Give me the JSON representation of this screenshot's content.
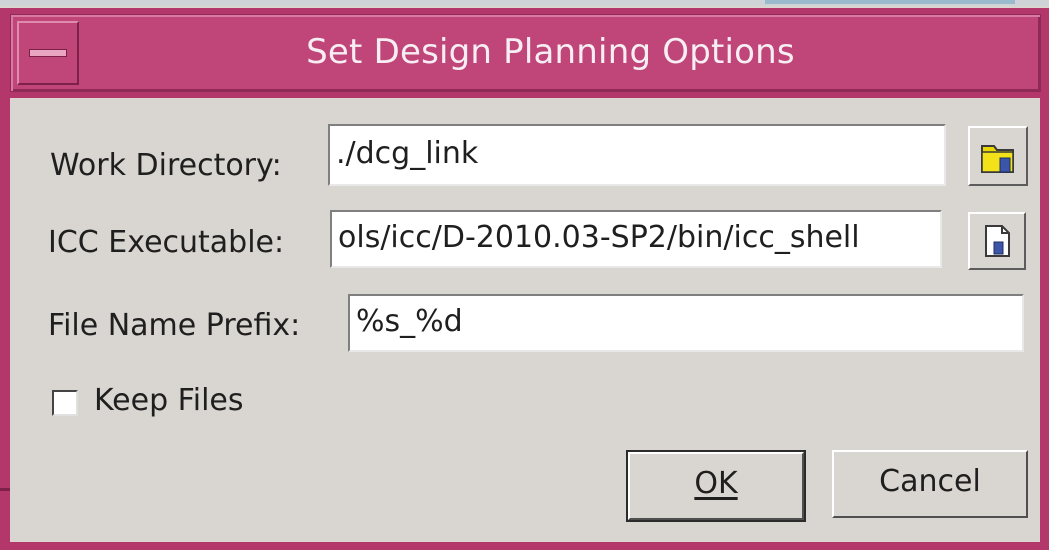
{
  "window": {
    "title": "Set Design Planning Options"
  },
  "form": {
    "work_directory": {
      "label": "Work Directory:",
      "value": "./dcg_link",
      "browse_icon": "folder-open-icon"
    },
    "icc_executable": {
      "label": "ICC Executable:",
      "value": "ols/icc/D-2010.03-SP2/bin/icc_shell",
      "browse_icon": "file-open-icon"
    },
    "file_name_prefix": {
      "label": "File Name Prefix:",
      "value": "%s_%d"
    },
    "keep_files": {
      "label": "Keep Files",
      "checked": false
    }
  },
  "buttons": {
    "ok_label": "OK",
    "cancel_label": "Cancel"
  },
  "colors": {
    "titlebar": "#c0467a",
    "frame": "#b3376a",
    "client": "#d9d5d0",
    "folder_yellow": "#e8d800"
  }
}
